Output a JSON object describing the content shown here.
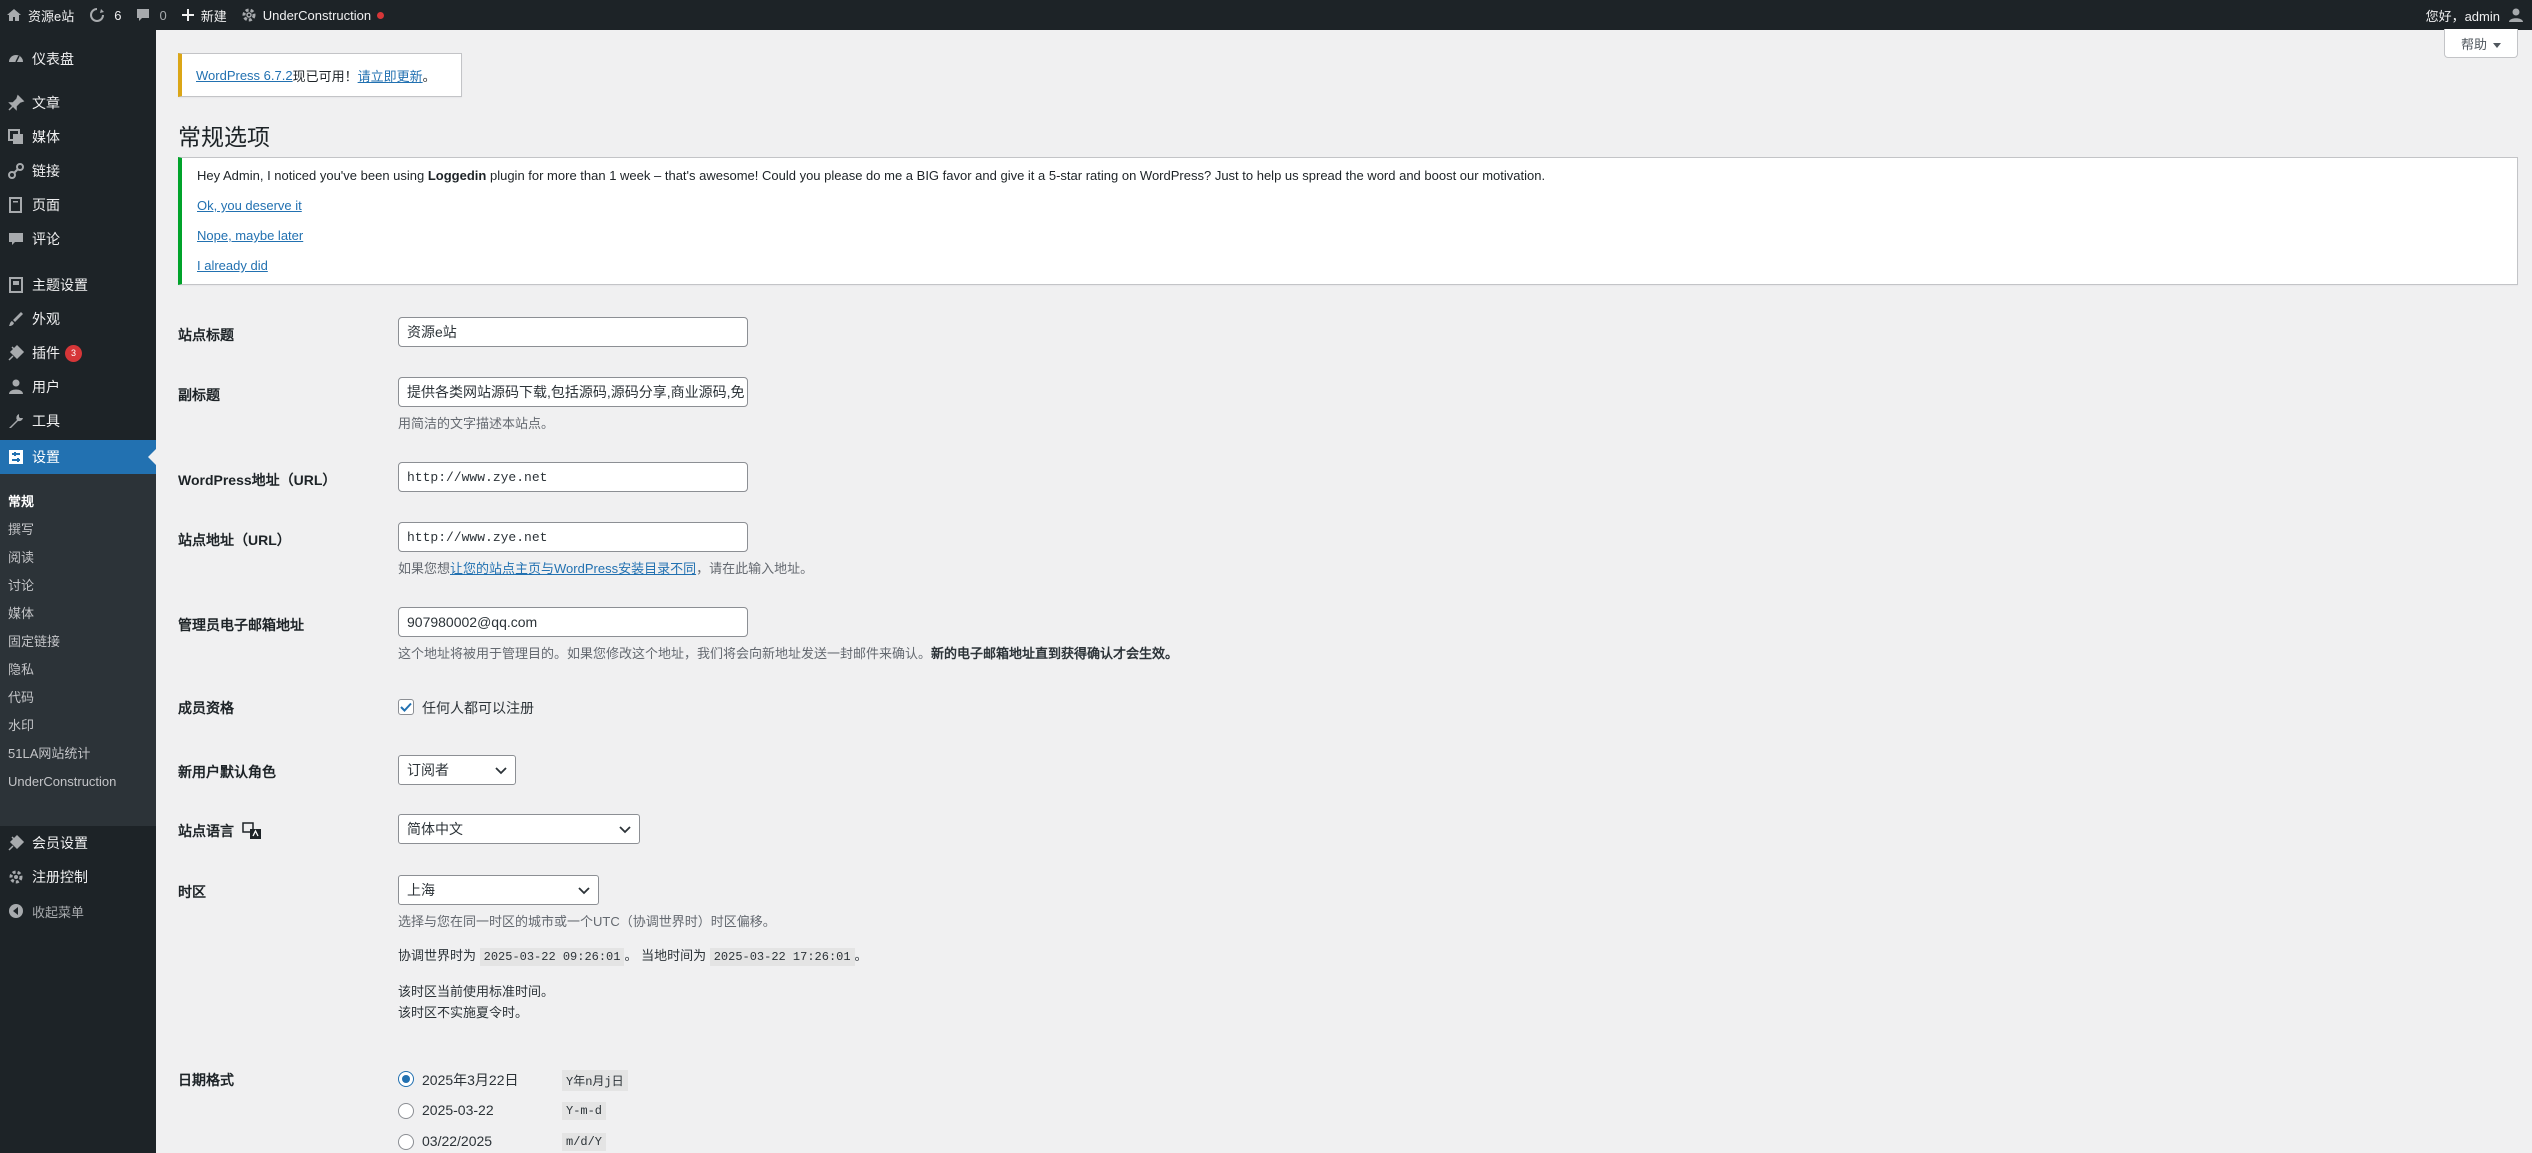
{
  "admin_bar": {
    "site_name": "资源e站",
    "updates_count": "6",
    "comments_count": "0",
    "new_label": "新建",
    "plugin_label": "UnderConstruction",
    "greeting": "您好，admin"
  },
  "sidebar": {
    "items": [
      {
        "label": "仪表盘",
        "icon": "dashboard-icon"
      },
      {
        "label": "文章",
        "icon": "pin-icon"
      },
      {
        "label": "媒体",
        "icon": "media-icon"
      },
      {
        "label": "链接",
        "icon": "link-icon"
      },
      {
        "label": "页面",
        "icon": "page-icon"
      },
      {
        "label": "评论",
        "icon": "comment-icon"
      },
      {
        "label": "主题设置",
        "icon": "theme-settings-icon"
      },
      {
        "label": "外观",
        "icon": "appearance-icon"
      },
      {
        "label": "插件",
        "icon": "plugin-icon",
        "badge": "3"
      },
      {
        "label": "用户",
        "icon": "user-icon"
      },
      {
        "label": "工具",
        "icon": "tools-icon"
      },
      {
        "label": "设置",
        "icon": "settings-icon"
      },
      {
        "label": "会员设置",
        "icon": "member-settings-icon"
      },
      {
        "label": "注册控制",
        "icon": "register-control-icon"
      },
      {
        "label": "收起菜单",
        "icon": "collapse-icon"
      }
    ],
    "submenu": [
      "常规",
      "撰写",
      "阅读",
      "讨论",
      "媒体",
      "固定链接",
      "隐私",
      "代码",
      "水印",
      "51LA网站统计",
      "UnderConstruction"
    ]
  },
  "help_tab": {
    "label": "帮助"
  },
  "update_nag": {
    "link1": "WordPress 6.7.2",
    "text": "现已可用！",
    "link2": "请立即更新",
    "end": "。"
  },
  "page_title": "常规选项",
  "rating_notice": {
    "message_pre": "Hey Admin, I noticed you've been using ",
    "plugin_name": "Loggedin",
    "message_post": " plugin for more than 1 week – that's awesome! Could you please do me a BIG favor and give it a 5-star rating on WordPress? Just to help us spread the word and boost our motivation.",
    "link_yes": "Ok, you deserve it",
    "link_later": "Nope, maybe later",
    "link_done": "I already did"
  },
  "settings": {
    "site_title_label": "站点标题",
    "site_title_value": "资源e站",
    "tagline_label": "副标题",
    "tagline_value": "提供各类网站源码下载,包括源码,源码分享,商业源码,免",
    "tagline_desc": "用简洁的文字描述本站点。",
    "wp_url_label": "WordPress地址（URL）",
    "wp_url_value": "http://www.zye.net",
    "site_url_label": "站点地址（URL）",
    "site_url_value": "http://www.zye.net",
    "site_url_desc_pre": "如果您想",
    "site_url_desc_link": "让您的站点主页与WordPress安装目录不同",
    "site_url_desc_post": "，请在此输入地址。",
    "email_label": "管理员电子邮箱地址",
    "email_value": "907980002@qq.com",
    "email_desc": "这个地址将被用于管理目的。如果您修改这个地址，我们将会向新地址发送一封邮件来确认。",
    "email_desc_bold": "新的电子邮箱地址直到获得确认才会生效。",
    "membership_label": "成员资格",
    "membership_checkbox": "任何人都可以注册",
    "membership_checked": true,
    "role_label": "新用户默认角色",
    "role_value": "订阅者",
    "language_label": "站点语言",
    "language_value": "简体中文",
    "timezone_label": "时区",
    "timezone_value": "上海",
    "timezone_desc": "选择与您在同一时区的城市或一个UTC（协调世界时）时区偏移。",
    "utc_label": "协调世界时为",
    "utc_time": "2025-03-22 09:26:01",
    "local_label": "。 当地时间为",
    "local_time": "2025-03-22 17:26:01",
    "local_end": "。",
    "std_time_note": "该时区当前使用标准时间。",
    "dst_note": "该时区不实施夏令时。",
    "date_format_label": "日期格式",
    "date_formats": [
      {
        "label": "2025年3月22日",
        "code": "Y年n月j日",
        "checked": true
      },
      {
        "label": "2025-03-22",
        "code": "Y-m-d",
        "checked": false
      },
      {
        "label": "03/22/2025",
        "code": "m/d/Y",
        "checked": false
      }
    ]
  }
}
